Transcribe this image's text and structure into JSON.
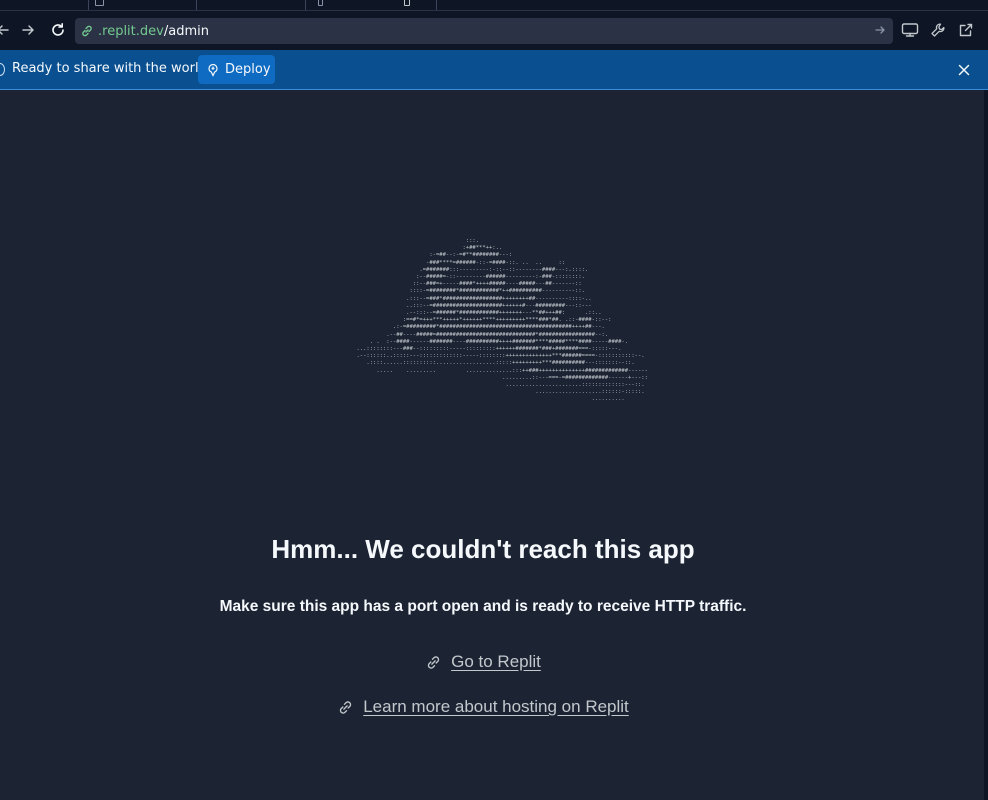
{
  "address_bar": {
    "url_domain": ".replit.dev",
    "url_path": "/admin"
  },
  "banner": {
    "message": "Ready to share with the world?",
    "deploy_label": "Deploy"
  },
  "error": {
    "title": "Hmm... We couldn't reach this app",
    "subtitle": "Make sure this app has a port open and is ready to receive HTTP traffic.",
    "link_replit": "Go to Replit",
    "link_hosting": "Learn more about hosting on Replit"
  },
  "colors": {
    "page_bg": "#1c2333",
    "chrome_bg": "#0e1525",
    "url_field_bg": "#2b3245",
    "banner_bg": "#0a4f8f",
    "deploy_button_bg": "#0f6bc2",
    "url_domain": "#73c990",
    "link_text": "#c2c8cc"
  },
  "icons": {
    "back": "arrow-left-icon",
    "forward": "arrow-right-icon",
    "reload": "reload-icon",
    "url_security": "link-icon",
    "url_go": "arrow-right-icon",
    "devtools": "monitor-icon",
    "tools": "wrench-icon",
    "open_new": "external-link-icon",
    "deploy": "deploy-icon",
    "close": "close-icon",
    "links": "link-icon"
  }
}
